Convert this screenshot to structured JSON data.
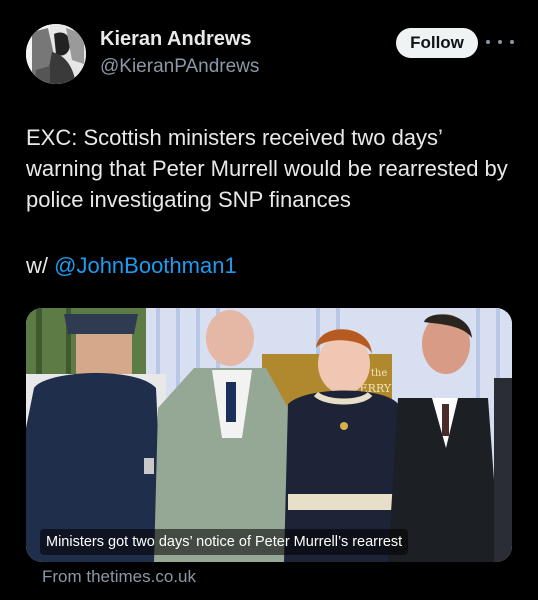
{
  "author": {
    "display_name": "Kieran Andrews",
    "handle": "@KieranPAndrews"
  },
  "actions": {
    "follow_label": "Follow"
  },
  "tweet": {
    "text": "EXC: Scottish ministers received two days’ warning that Peter Murrell would be rearrested by police investigating SNP finances",
    "mention_prefix": "w/",
    "mention": "@JohnBoothman1"
  },
  "media": {
    "caption": "Ministers got two days’ notice of Peter Murrell’s rearrest",
    "source": "From thetimes.co.uk",
    "sign_text_1": "of the",
    "sign_text_2": "FERRY"
  },
  "icons": {
    "more": "more-horizontal-icon"
  }
}
